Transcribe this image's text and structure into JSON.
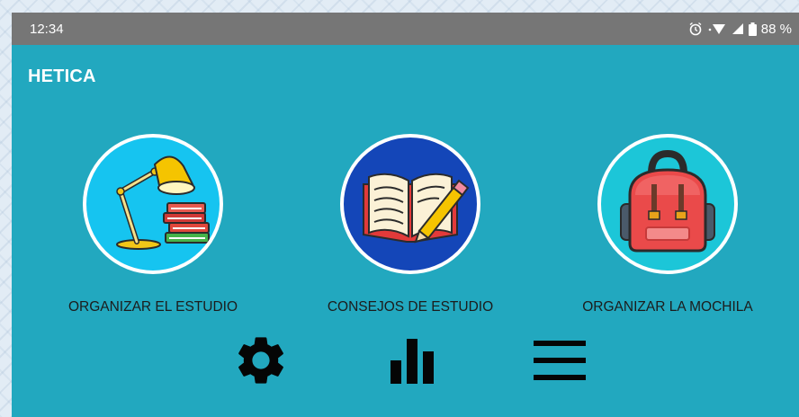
{
  "status_bar": {
    "time": "12:34",
    "battery": "88 %",
    "icons": [
      "alarm-icon",
      "wifi-icon",
      "signal-icon",
      "battery-icon"
    ]
  },
  "app": {
    "title": "HETICA"
  },
  "tiles": [
    {
      "label": "ORGANIZAR EL ESTUDIO",
      "icon": "desk-lamp-books-icon",
      "circle_color": "#16c4f0"
    },
    {
      "label": "CONSEJOS DE ESTUDIO",
      "icon": "open-book-pencil-icon",
      "circle_color": "#1446b8"
    },
    {
      "label": "ORGANIZAR LA MOCHILA",
      "icon": "backpack-icon",
      "circle_color": "#1cc6d8"
    }
  ],
  "bottom_bar": {
    "items": [
      "settings-gear-icon",
      "stats-bars-icon",
      "menu-icon"
    ]
  },
  "colors": {
    "app_background": "#22a8bf",
    "status_bar": "#767676",
    "title_text": "#ffffff",
    "label_text": "#1c1c1c"
  }
}
